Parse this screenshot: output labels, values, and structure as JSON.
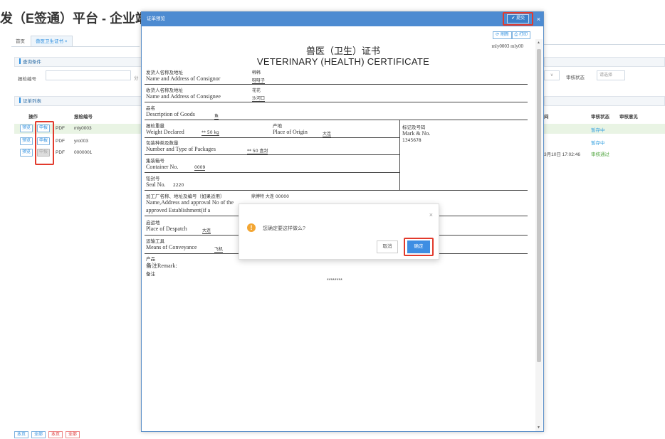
{
  "app": {
    "title": "发（E签通）平台 - 企业端"
  },
  "tabs": [
    {
      "label": "首页"
    },
    {
      "label": "兽医卫生证书 ×"
    }
  ],
  "query": {
    "section_title": "查询条件",
    "inspection_no_label": "报检编号",
    "cut_label": "分",
    "status_label": "审核状态",
    "status_placeholder": "请选择",
    "select_arrow": "∨"
  },
  "list": {
    "section_title": "证单列表",
    "columns": {
      "action": "操作",
      "inspection_no": "报检编号",
      "col_right": "间",
      "status": "审核状态",
      "opinion": "审核意见"
    },
    "rows": [
      {
        "preview": "预览",
        "declare": "申报",
        "pdf": "PDF",
        "no": "mly0003",
        "time": "",
        "status": "暂存中",
        "highlight": true
      },
      {
        "preview": "预览",
        "declare": "申报",
        "pdf": "PDF",
        "no": "yro003",
        "time": "",
        "status": "暂存中",
        "highlight": false
      },
      {
        "preview": "预览",
        "declare": "申报",
        "pdf": "PDF",
        "no": "0000001",
        "time": "3月10日 17:02:46",
        "status": "审核通过",
        "highlight": false
      }
    ]
  },
  "footer": {
    "btns": [
      "本页",
      "全部",
      "本页",
      "全部"
    ]
  },
  "cert_window": {
    "title": "证单预览",
    "submit_label": "✔ 提交",
    "close": "×",
    "refresh_label": "⟳ 刷新",
    "print_label": "⎙ 打印",
    "doc_id": "mly0003 mly00",
    "title_cn": "兽医（卫生）证书",
    "title_en": "VETERINARY (HEALTH) CERTIFICATE",
    "consignor_cn": "发货人名称及地址",
    "consignor_en": "Name and Address of Consignor",
    "consignor_val1": "韩韩",
    "consignor_val2": "呀呀子",
    "consignee_cn": "收货人名称及地址",
    "consignee_en": "Name and Address of Consignee",
    "consignee_val1": "花花",
    "consignee_val2": "沙河口",
    "goods_cn": "品名",
    "goods_en": "Description of Goods",
    "goods_val": "鱼",
    "weight_cn": "报检重量",
    "weight_en": "Weight Declared",
    "weight_val": "** 50 kg",
    "origin_cn": "产地",
    "origin_en": "Place of Origin",
    "origin_val": "大连",
    "mark_cn": "标记及号码",
    "mark_en": "Mark & No.",
    "mark_val": "1345678",
    "packages_cn": "包装种类及数量",
    "packages_en": "Number and Type of Packages",
    "packages_val": "** 50 盒封",
    "container_cn": "集装箱号",
    "container_en": "Container No.",
    "container_val": "0009",
    "seal_cn": "铅封号",
    "seal_en": "Seal No.",
    "seal_val": "2220",
    "factory_cn": "加工厂名称、地址及编号（如果适用）",
    "factory_val": "鼎博特 大连 00000",
    "factory_en1": "Name,Address and approval No of the",
    "factory_en2": "approved Establishment(if a",
    "despatch_cn": "启运地",
    "despatch_en": "Place of Despatch",
    "despatch_val": "大连",
    "conveyance_cn": "运输工具",
    "conveyance_en": "Means of Conveyance",
    "conveyance_val": "飞机",
    "port_cn": "产品",
    "remark_en": "备注Remark:",
    "remark_cn": "备注",
    "stars": "********",
    "scroll_up": "▲",
    "scroll_down": "▼"
  },
  "confirm": {
    "message": "您确定要这样做么?",
    "cancel_label": "取消",
    "ok_label": "确定",
    "close": "×",
    "icon": "!"
  },
  "colors": {
    "accent": "#3e8ee3",
    "titlebar": "#4d8bd1",
    "highlight_box": "#e23a2c",
    "warning": "#f3a633",
    "status_pass": "#55a844"
  }
}
